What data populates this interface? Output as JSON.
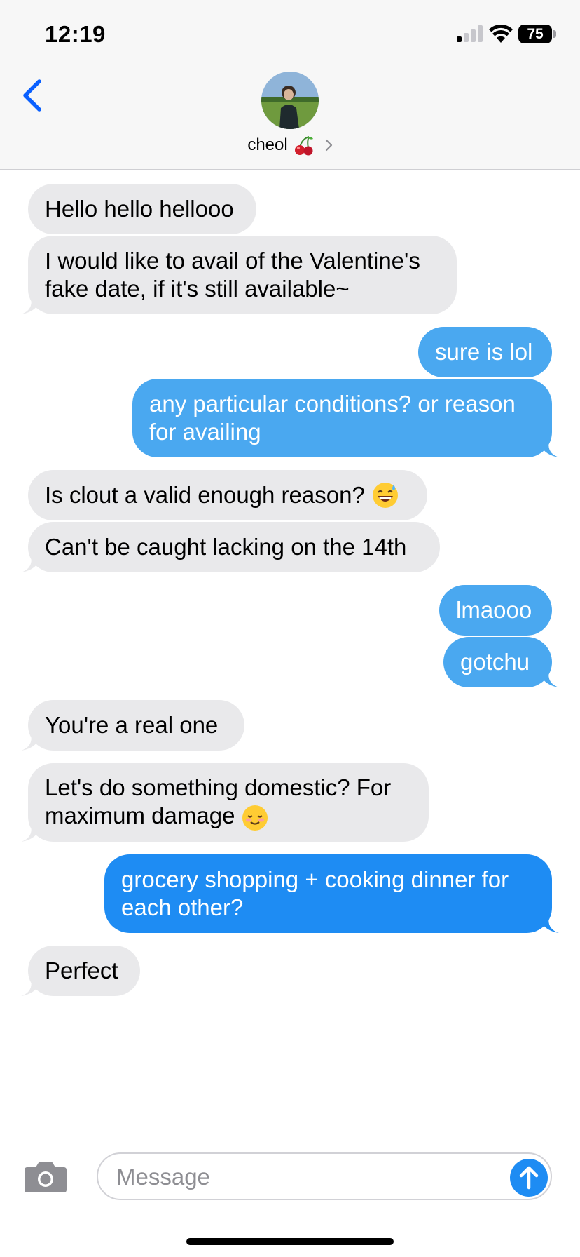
{
  "status_bar": {
    "time": "12:19",
    "battery": "75"
  },
  "header": {
    "contact_name": "cheol",
    "contact_emoji_icon": "cherries-icon"
  },
  "messages": [
    {
      "from": "them",
      "text": "Hello hello hellooo"
    },
    {
      "from": "them",
      "text": "I would like to avail of the Valentine's fake date, if it's still available~"
    },
    {
      "from": "me",
      "text": "sure is lol"
    },
    {
      "from": "me",
      "text": "any particular conditions? or reason for availing"
    },
    {
      "from": "them",
      "text": "Is clout a valid enough reason?",
      "emoji_icon": "grinning-sweat-emoji-icon"
    },
    {
      "from": "them",
      "text": "Can't be caught lacking on the 14th"
    },
    {
      "from": "me",
      "text": "lmaooo"
    },
    {
      "from": "me",
      "text": "gotchu"
    },
    {
      "from": "them",
      "text": "You're a real one"
    },
    {
      "from": "them",
      "text": "Let's do something domestic? For maximum damage",
      "emoji_icon": "smiling-blush-emoji-icon"
    },
    {
      "from": "me",
      "text": "grocery shopping + cooking dinner for each other?"
    },
    {
      "from": "them",
      "text": "Perfect"
    }
  ],
  "composer": {
    "placeholder": "Message"
  },
  "colors": {
    "incoming": "#e9e9eb",
    "outgoing_light": "#4aa8f0",
    "outgoing": "#1e8cf3",
    "accent": "#0a60ff"
  }
}
